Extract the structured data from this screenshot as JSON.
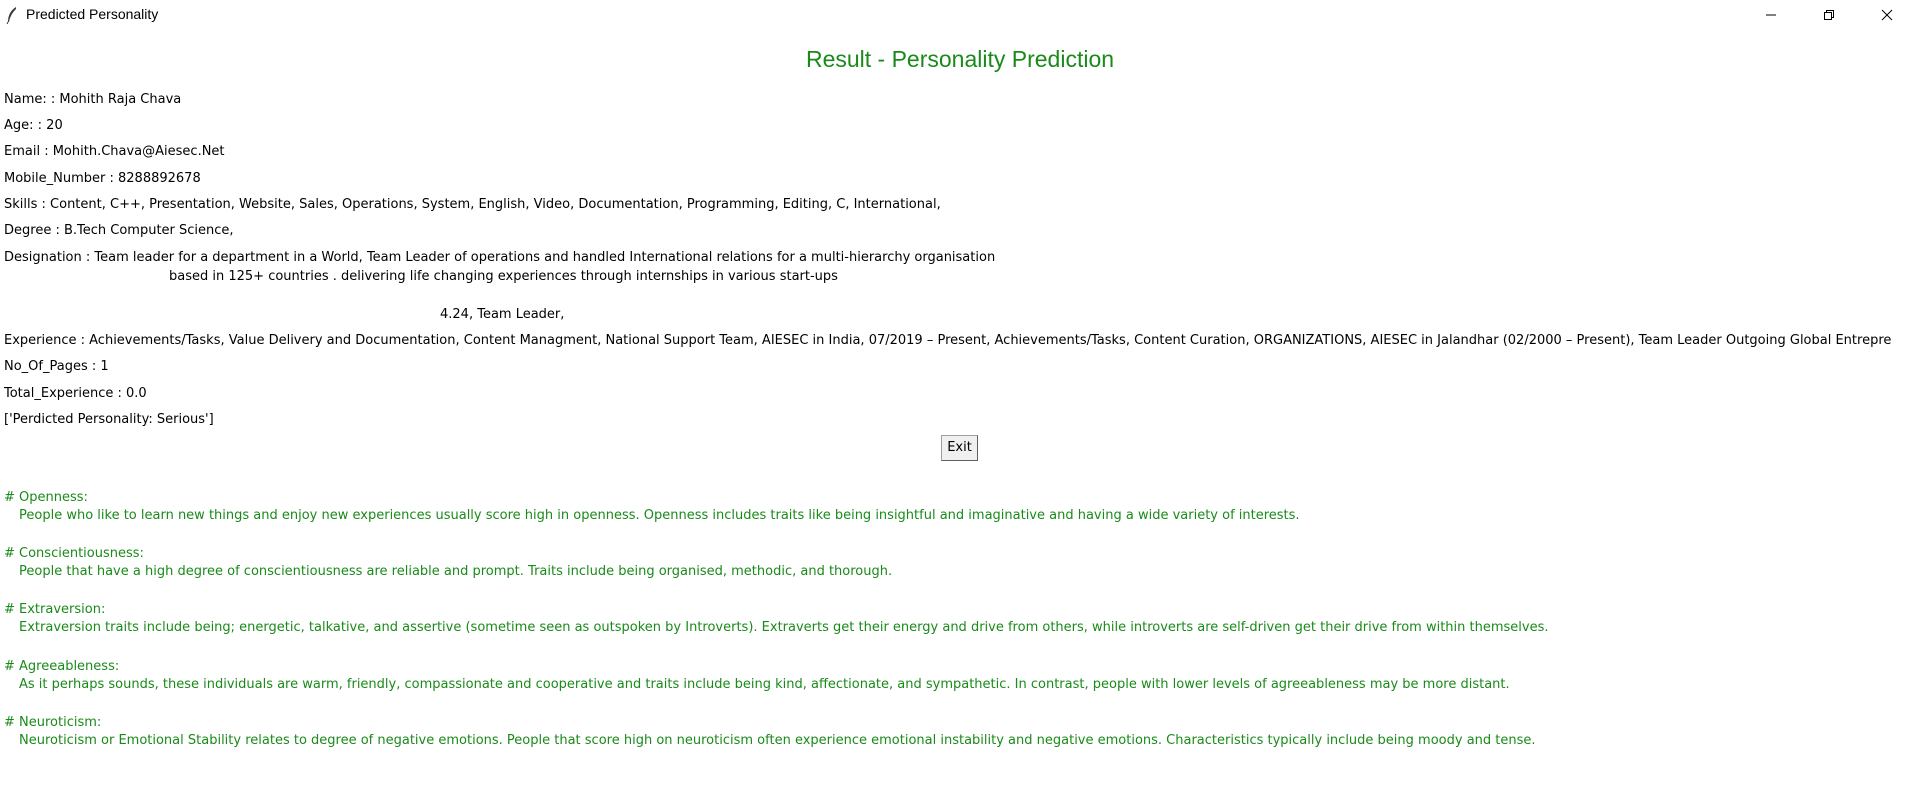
{
  "window": {
    "title": "Predicted Personality",
    "icon": "feather-icon"
  },
  "heading": "Result - Personality Prediction",
  "colors": {
    "accent_green": "#1a8a1a"
  },
  "fields": {
    "name": "Name: : Mohith Raja Chava",
    "age": "Age: : 20",
    "email": "Email : Mohith.Chava@Aiesec.Net",
    "mobile": "Mobile_Number : 8288892678",
    "skills": "Skills : Content, C++, Presentation, Website, Sales, Operations, System, English, Video, Documentation, Programming, Editing, C, International,",
    "degree": "Degree : B.Tech Computer Science,",
    "designation_line1": "Designation : Team leader for a department in a World, Team Leader of operations and handled International relations for a multi-hierarchy organisation",
    "designation_line2": "based in 125+ countries . delivering life changing experiences through internships in various start-ups",
    "designation_line3": "4.24, Team Leader,",
    "experience": "Experience : Achievements/Tasks, Value Delivery and Documentation, Content Managment, National Support Team, AIESEC in India, 07/2019 – Present, Achievements/Tasks, Content Curation, ORGANIZATIONS, AIESEC in Jalandhar (02/2000 – Present), Team Leader Outgoing Global Entrepre",
    "pages": "No_Of_Pages : 1",
    "total_experience": "Total_Experience : 0.0",
    "prediction": "['Perdicted Personality: Serious']"
  },
  "exit_button": "Exit",
  "traits": [
    {
      "heading": "# Openness:",
      "description": "People who like to learn new things and enjoy new experiences usually score high in openness. Openness includes traits like being insightful and imaginative and having a wide variety of interests."
    },
    {
      "heading": "# Conscientiousness:",
      "description": "People that have a high degree of conscientiousness are reliable and prompt. Traits include being organised, methodic, and thorough."
    },
    {
      "heading": "# Extraversion:",
      "description": "Extraversion traits include being; energetic, talkative, and assertive (sometime seen as outspoken by Introverts). Extraverts get their energy and drive from others, while introverts are self-driven get their drive from within themselves."
    },
    {
      "heading": "# Agreeableness:",
      "description": "As it perhaps sounds, these individuals are warm, friendly, compassionate and cooperative and traits include being kind, affectionate, and sympathetic. In contrast, people with lower levels of agreeableness may be more distant."
    },
    {
      "heading": "# Neuroticism:",
      "description": "Neuroticism or Emotional Stability relates to degree of negative emotions. People that score high on neuroticism often experience emotional instability and negative emotions. Characteristics typically include being moody and tense."
    }
  ]
}
